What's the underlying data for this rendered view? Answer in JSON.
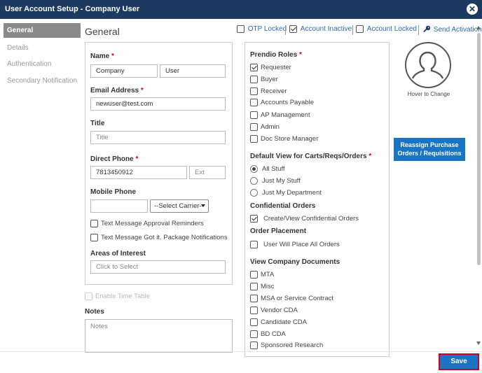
{
  "window": {
    "title": "User Account Setup - Company User"
  },
  "sidebar": {
    "items": [
      {
        "label": "General"
      },
      {
        "label": "Details"
      },
      {
        "label": "Authentication"
      },
      {
        "label": "Secondary Notification"
      }
    ]
  },
  "heading": "General",
  "flags": {
    "otp_locked": {
      "label": "OTP Locked",
      "checked": false
    },
    "account_inactive": {
      "label": "Account Inactive",
      "checked": true
    },
    "account_locked": {
      "label": "Account Locked",
      "checked": false
    },
    "send_activation": "Send Activation"
  },
  "form": {
    "name_label": "Name",
    "first_name": "Company",
    "last_name": "User",
    "email_label": "Email Address",
    "email": "newuser@test.com",
    "title_label": "Title",
    "title_placeholder": "Title",
    "direct_phone_label": "Direct Phone",
    "direct_phone": "7813450912",
    "ext_placeholder": "Ext",
    "mobile_label": "Mobile Phone",
    "carrier_select": "--Select Carrier--",
    "sms_approval": "Text Message Approval Reminders",
    "sms_package": "Text Message Got it. Package Notifications",
    "interest_label": "Areas of Interest",
    "interest_placeholder": "Click to Select",
    "enable_timetable": "Enable Time Table",
    "notes_label": "Notes",
    "notes_placeholder": "Notes"
  },
  "required_marker": "*",
  "roles": {
    "label": "Prendio Roles",
    "items": [
      "Requester",
      "Buyer",
      "Receiver",
      "Accounts Payable",
      "AP Management",
      "Admin",
      "Doc Store Manager"
    ],
    "checked": [
      true,
      false,
      false,
      false,
      false,
      false,
      false
    ]
  },
  "default_view": {
    "label": "Default View for Carts/Reqs/Orders",
    "options": [
      "All Stuff",
      "Just My Stuff",
      "Just My Department"
    ],
    "selected": "All Stuff"
  },
  "confidential": {
    "label": "Confidential Orders",
    "option": "Create/View Confidential Orders",
    "checked": true
  },
  "order_placement": {
    "label": "Order Placement",
    "option": "User Will Place All Orders",
    "checked": false
  },
  "documents": {
    "label": "View Company Documents",
    "items": [
      "MTA",
      "Misc",
      "MSA or Service Contract",
      "Vendor CDA",
      "Candidate CDA",
      "BD CDA",
      "Sponsored Research"
    ]
  },
  "avatar_caption": "Hover to Change",
  "reassign_button": {
    "line1": "Reassign Purchase",
    "line2": "Orders / Requisitions"
  },
  "save_button": "Save",
  "icons": {
    "close": "close-icon",
    "key": "key-icon",
    "avatar": "user-avatar-icon"
  },
  "colors": {
    "titlebar": "#1d3a60",
    "primary": "#1a74c4",
    "required": "#d0021b",
    "link": "#2b6cb0"
  }
}
